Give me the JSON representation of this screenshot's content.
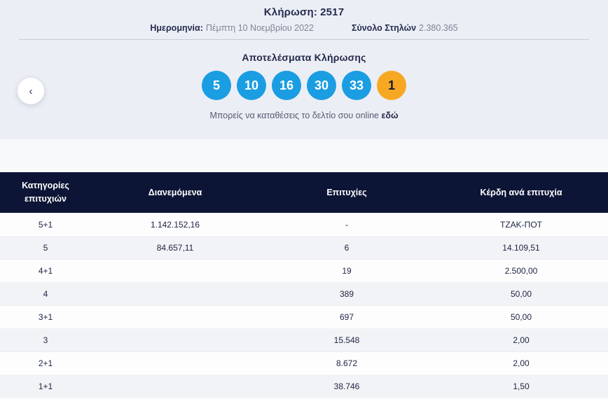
{
  "header": {
    "draw_label": "Κλήρωση:",
    "draw_number": "2517",
    "date_label": "Ημερομηνία:",
    "date_value": "Πέμπτη 10 Νοεμβρίου 2022",
    "columns_label": "Σύνολο Στηλών",
    "columns_value": "2.380.365"
  },
  "results": {
    "title": "Αποτελέσματα Κλήρωσης",
    "online_text": "Μπορείς να καταθέσεις το δελτίο σου online",
    "online_link_label": "εδώ",
    "prev_icon": "‹"
  },
  "draw": {
    "numbers": [
      "5",
      "10",
      "16",
      "30",
      "33"
    ],
    "joker": "1"
  },
  "colors": {
    "ball_blue": "#1b9de2",
    "ball_orange": "#f7a823",
    "header_navy": "#0c1535"
  },
  "table": {
    "headers": [
      "Κατηγορίες επιτυχιών",
      "Διανεμόμενα",
      "Επιτυχίες",
      "Κέρδη ανά επιτυχία"
    ],
    "rows": [
      {
        "category": "5+1",
        "distributed": "1.142.152,16",
        "winners": "-",
        "prize": "ΤΖΑΚ-ΠΟΤ"
      },
      {
        "category": "5",
        "distributed": "84.657,11",
        "winners": "6",
        "prize": "14.109,51"
      },
      {
        "category": "4+1",
        "distributed": "",
        "winners": "19",
        "prize": "2.500,00"
      },
      {
        "category": "4",
        "distributed": "",
        "winners": "389",
        "prize": "50,00"
      },
      {
        "category": "3+1",
        "distributed": "",
        "winners": "697",
        "prize": "50,00"
      },
      {
        "category": "3",
        "distributed": "",
        "winners": "15.548",
        "prize": "2,00"
      },
      {
        "category": "2+1",
        "distributed": "",
        "winners": "8.672",
        "prize": "2,00"
      },
      {
        "category": "1+1",
        "distributed": "",
        "winners": "38.746",
        "prize": "1,50"
      }
    ]
  }
}
